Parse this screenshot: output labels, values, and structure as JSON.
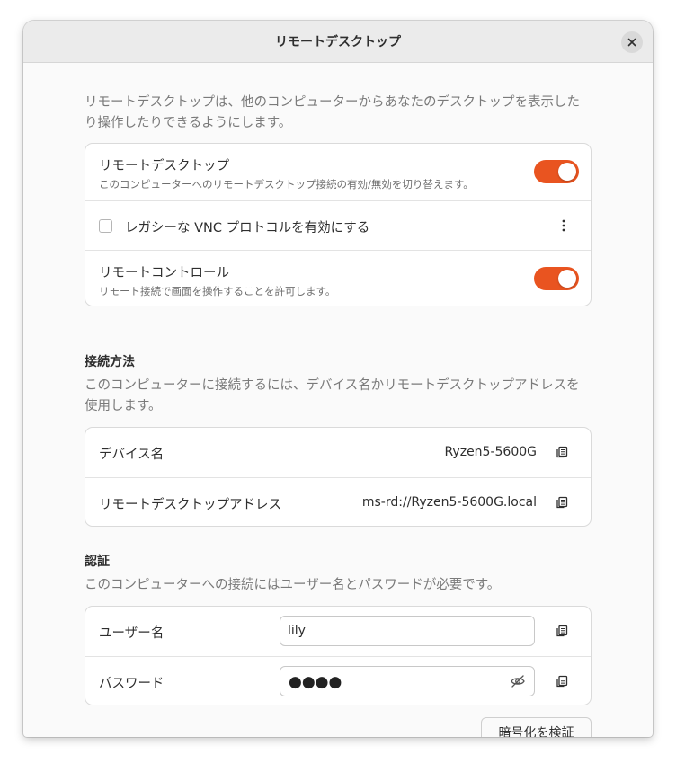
{
  "window": {
    "title": "リモートデスクトップ"
  },
  "intro": "リモートデスクトップは、他のコンピューターからあなたのデスクトップを表示したり操作したりできるようにします。",
  "toggles_card": {
    "remote_desktop": {
      "title": "リモートデスクトップ",
      "subtitle": "このコンピューターへのリモートデスクトップ接続の有効/無効を切り替えます。",
      "enabled": true
    },
    "vnc": {
      "label": "レガシーな VNC プロトコルを有効にする",
      "checked": false
    },
    "remote_control": {
      "title": "リモートコントロール",
      "subtitle": "リモート接続で画面を操作することを許可します。",
      "enabled": true
    }
  },
  "connection": {
    "heading": "接続方法",
    "description": "このコンピューターに接続するには、デバイス名かリモートデスクトップアドレスを使用します。",
    "device_name_label": "デバイス名",
    "device_name_value": "Ryzen5-5600G",
    "address_label": "リモートデスクトップアドレス",
    "address_value": "ms-rd://Ryzen5-5600G.local"
  },
  "auth": {
    "heading": "認証",
    "description": "このコンピューターへの接続にはユーザー名とパスワードが必要です。",
    "username_label": "ユーザー名",
    "username_value": "lily",
    "password_label": "パスワード",
    "password_mask": "●●●●"
  },
  "verify_button": "暗号化を検証",
  "colors": {
    "accent": "#e95420"
  },
  "icons": [
    "close-icon",
    "kebab-menu-icon",
    "copy-icon",
    "eye-hidden-icon"
  ]
}
